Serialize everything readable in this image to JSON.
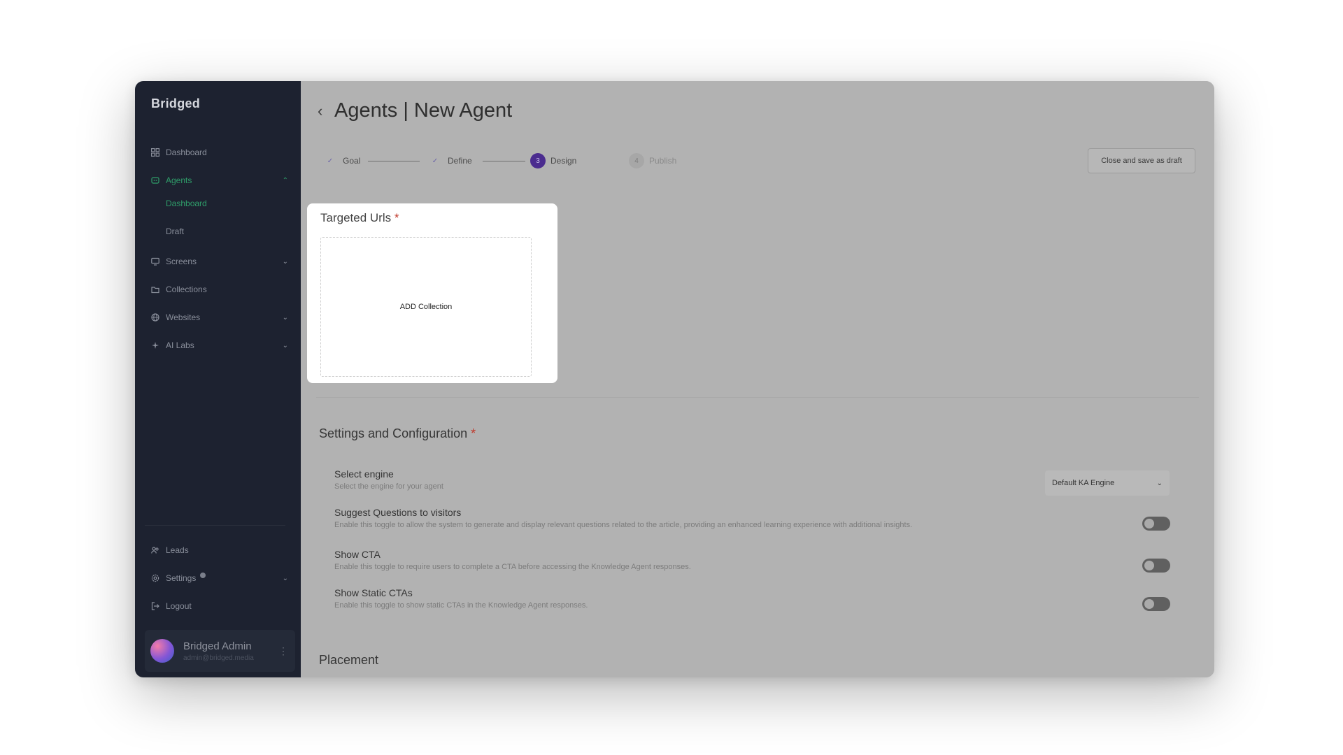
{
  "sidebar": {
    "logo": "Bridged",
    "nav": {
      "dashboard": "Dashboard",
      "agents": "Agents",
      "agents_dashboard": "Dashboard",
      "agents_draft": "Draft",
      "screens": "Screens",
      "collections": "Collections",
      "websites": "Websites",
      "ai_labs": "AI Labs",
      "leads": "Leads",
      "settings": "Settings",
      "logout": "Logout"
    },
    "profile": {
      "name": "Bridged Admin",
      "email": "admin@bridged.media"
    }
  },
  "header": {
    "title": "Agents | New Agent",
    "close_draft_label": "Close and save as draft"
  },
  "stepper": {
    "steps": [
      {
        "label": "Goal",
        "marker": "✓",
        "state": "done"
      },
      {
        "label": "Define",
        "marker": "✓",
        "state": "done"
      },
      {
        "label": "Design",
        "marker": "3",
        "state": "current"
      },
      {
        "label": "Publish",
        "marker": "4",
        "state": "todo"
      }
    ]
  },
  "targeted_urls": {
    "title": "Targeted Urls",
    "required_mark": "*",
    "add_label": "ADD Collection"
  },
  "settings": {
    "title": "Settings and Configuration",
    "required_mark": "*",
    "engine": {
      "title": "Select engine",
      "desc": "Select the engine for your agent",
      "value": "Default KA Engine"
    },
    "suggest_questions": {
      "title": "Suggest Questions to visitors",
      "desc": "Enable this toggle to allow the system to generate and display relevant questions related to the article, providing an enhanced learning experience with additional insights.",
      "enabled": false
    },
    "show_cta": {
      "title": "Show CTA",
      "desc": "Enable this toggle to require users to complete a CTA before accessing the Knowledge Agent responses.",
      "enabled": false
    },
    "show_static_ctas": {
      "title": "Show Static CTAs",
      "desc": "Enable this toggle to show static CTAs in the Knowledge Agent responses.",
      "enabled": false
    }
  },
  "placement": {
    "title": "Placement"
  },
  "colors": {
    "sidebar_bg": "#1d2230",
    "accent_green": "#2f9e6a",
    "step_current": "#4b2c8f",
    "overlay": "#b2b2b2"
  }
}
